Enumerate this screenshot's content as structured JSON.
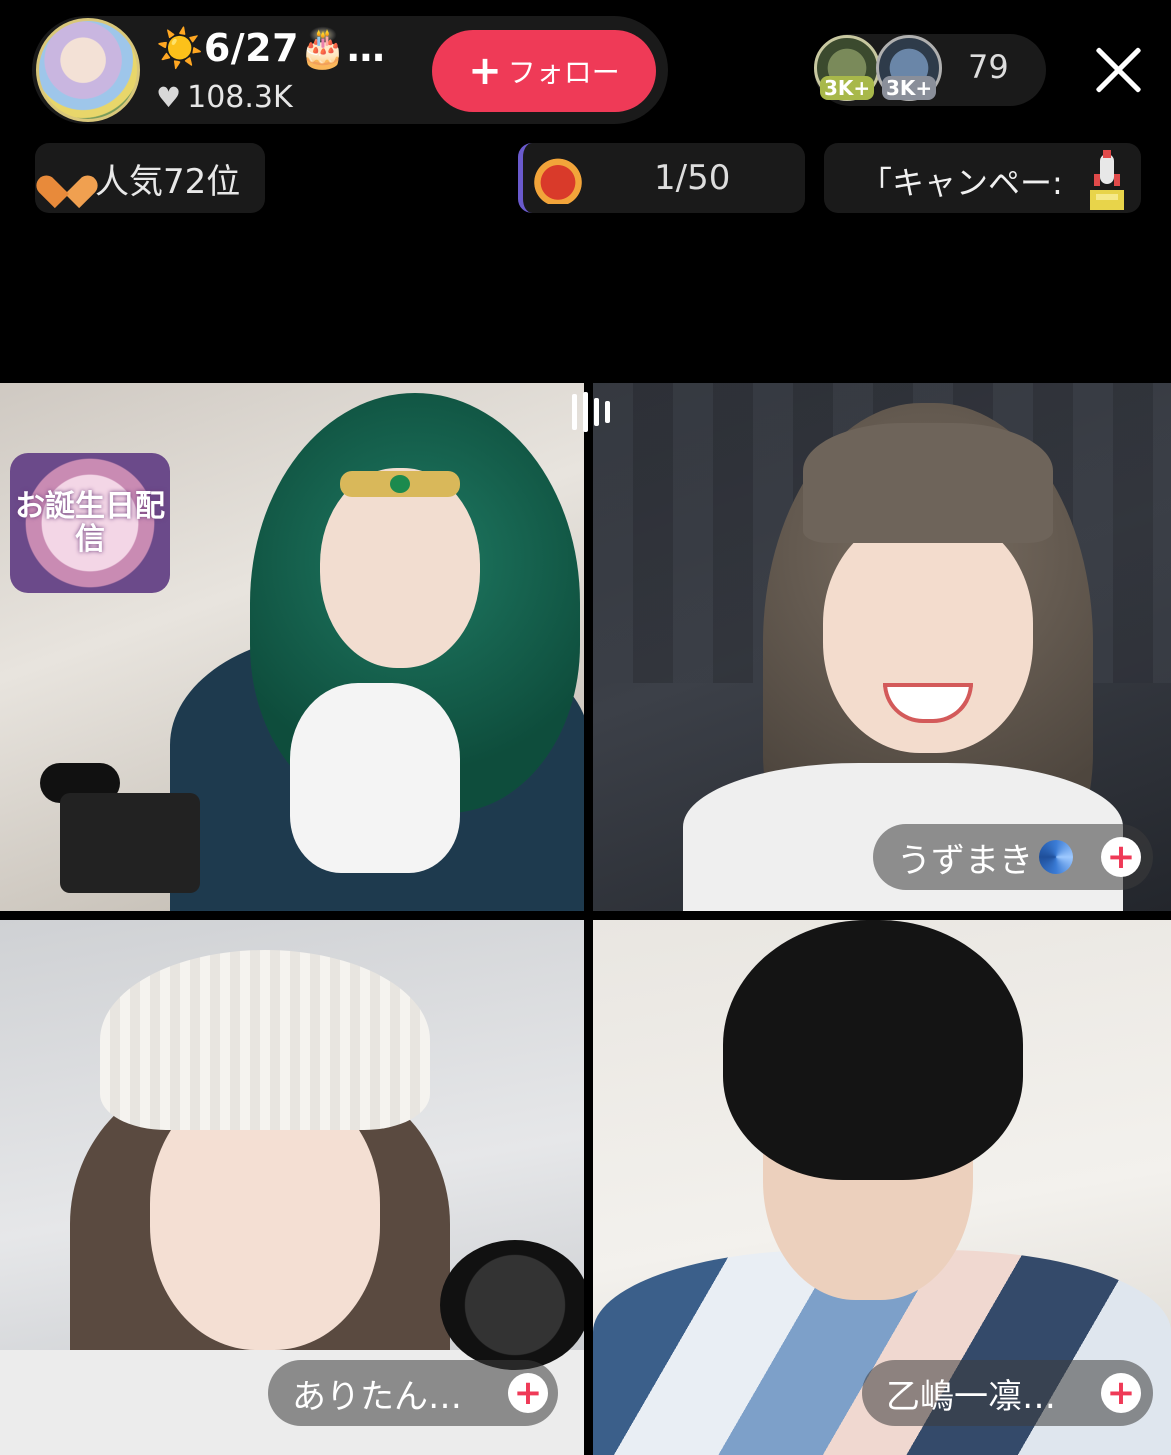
{
  "header": {
    "host_title": "☀️6/27🎂…",
    "likes": "108.3K",
    "follow_label": "フォロー",
    "viewer_badges": [
      "3K+",
      "3K+"
    ],
    "viewer_count": "79"
  },
  "info_row": {
    "rank_label": "人気72位",
    "goal_progress": "1/50",
    "campaign_label": "「キャンペー:"
  },
  "tiles": [
    {
      "badge_text": "お誕生日配信",
      "name": ""
    },
    {
      "name": "うずまき"
    },
    {
      "name": "ありたん…"
    },
    {
      "name": "乙嶋一凛…"
    }
  ],
  "icons": {
    "heart": "heart-icon",
    "plus": "plus-icon",
    "close": "close-icon",
    "spiral": "spiral-icon",
    "rocket": "rocket-icon",
    "goal": "gift-goal-icon"
  },
  "colors": {
    "follow_button": "#ef3a57",
    "rank_heart": "#f0a050",
    "background": "#000000"
  }
}
